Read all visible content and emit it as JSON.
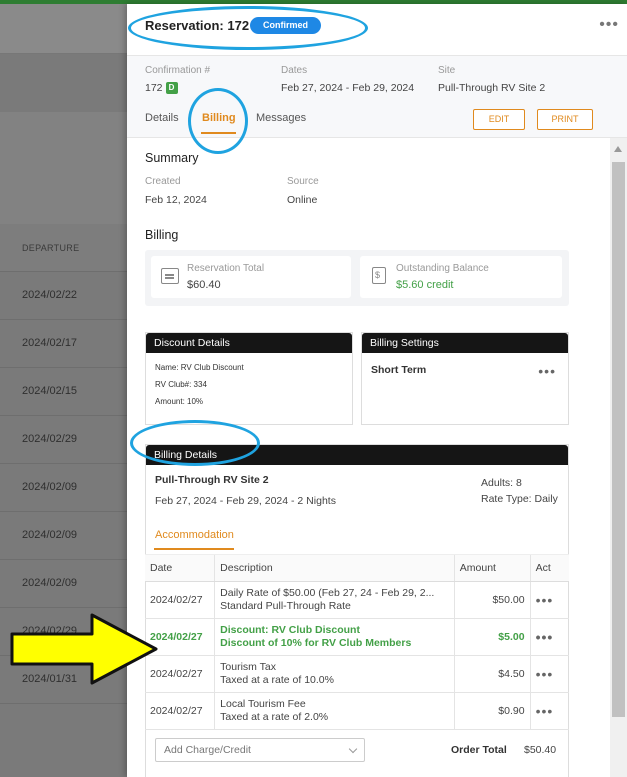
{
  "background": {
    "column_header": "DEPARTURE",
    "rows": [
      "2024/02/22",
      "2024/02/17",
      "2024/02/15",
      "2024/02/29",
      "2024/02/09",
      "2024/02/09",
      "2024/02/09",
      "2024/02/29",
      "2024/01/31"
    ]
  },
  "reservation": {
    "title": "Reservation: 172",
    "status": "Confirmed",
    "menu_icon": "more-horizontal-icon"
  },
  "meta": {
    "confirmation_label": "Confirmation #",
    "confirmation_value": "172",
    "confirmation_badge": "D",
    "dates_label": "Dates",
    "dates_value": "Feb 27, 2024 - Feb 29, 2024",
    "site_label": "Site",
    "site_value": "Pull-Through RV Site 2"
  },
  "tabs": [
    {
      "label": "Details",
      "active": false
    },
    {
      "label": "Billing",
      "active": true
    },
    {
      "label": "Messages",
      "active": false
    }
  ],
  "actions": {
    "edit": "EDIT",
    "print": "PRINT"
  },
  "summary": {
    "title": "Summary",
    "created_label": "Created",
    "created_value": "Feb 12, 2024",
    "source_label": "Source",
    "source_value": "Online"
  },
  "billing": {
    "title": "Billing",
    "total_label": "Reservation Total",
    "total_value": "$60.40",
    "balance_label": "Outstanding Balance",
    "balance_value": "$5.60 credit"
  },
  "discount_details": {
    "title": "Discount Details",
    "name": "Name: RV Club Discount",
    "club": "RV Club#: 334",
    "amount": "Amount: 10%"
  },
  "billing_settings": {
    "title": "Billing Settings",
    "value": "Short Term"
  },
  "billing_details": {
    "title": "Billing Details",
    "site": "Pull-Through RV Site 2",
    "dates": "Feb 27, 2024 - Feb 29, 2024 - 2 Nights",
    "adults": "Adults: 8",
    "rate_type": "Rate Type: Daily",
    "section_tab": "Accommodation",
    "columns": [
      "Date",
      "Description",
      "Amount",
      "Act"
    ],
    "lines": [
      {
        "date": "2024/02/27",
        "desc1": "Daily Rate of $50.00 (Feb 27, 24 - Feb 29, 2...",
        "desc2": "Standard Pull-Through Rate",
        "amount": "$50.00",
        "discount": false
      },
      {
        "date": "2024/02/27",
        "desc1": "Discount: RV Club Discount",
        "desc2": "Discount of 10% for RV Club Members",
        "amount": "$5.00",
        "discount": true
      },
      {
        "date": "2024/02/27",
        "desc1": "Tourism Tax",
        "desc2": "Taxed at a rate of 10.0%",
        "amount": "$4.50",
        "discount": false
      },
      {
        "date": "2024/02/27",
        "desc1": "Local Tourism Fee",
        "desc2": "Taxed at a rate of 2.0%",
        "amount": "$0.90",
        "discount": false
      }
    ],
    "add_charge_placeholder": "Add Charge/Credit",
    "order_total_label": "Order Total",
    "order_total_value": "$50.40"
  },
  "colors": {
    "accent": "#e08a1e",
    "status_blue": "#1e88e5",
    "credit_green": "#43a047",
    "annotation_ring": "#1fa3e0",
    "annotation_arrow": "#ffff00"
  }
}
